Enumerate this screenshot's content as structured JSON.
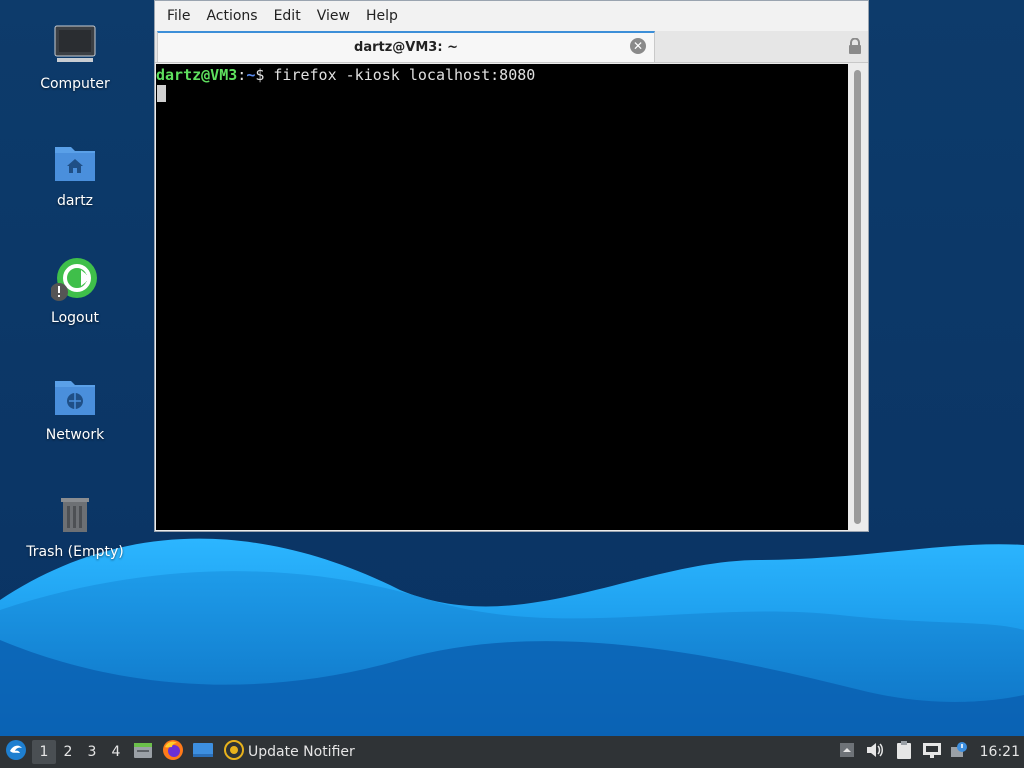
{
  "desktop": {
    "icons": [
      {
        "label": "Computer",
        "icon": "computer-icon"
      },
      {
        "label": "dartz",
        "icon": "home-folder-icon"
      },
      {
        "label": "Logout",
        "icon": "logout-icon"
      },
      {
        "label": "Network",
        "icon": "network-folder-icon"
      },
      {
        "label": "Trash (Empty)",
        "icon": "trash-icon"
      }
    ]
  },
  "terminal": {
    "menu": [
      "File",
      "Actions",
      "Edit",
      "View",
      "Help"
    ],
    "tab_title": "dartz@VM3: ~",
    "prompt_user": "dartz@VM3",
    "prompt_colon": ":",
    "prompt_path": "~",
    "prompt_symbol": "$ ",
    "command": "firefox -kiosk localhost:8080"
  },
  "taskbar": {
    "workspaces": [
      "1",
      "2",
      "3",
      "4"
    ],
    "active_workspace": "1",
    "launchers": [
      "start-menu-icon",
      "file-manager-icon",
      "firefox-icon",
      "show-desktop-icon"
    ],
    "update_notifier": "Update Notifier",
    "clock": "16:21"
  },
  "colors": {
    "desktop_dark": "#0b3a6a",
    "wave_light": "#1fa0f0",
    "prompt_green": "#5ee05e",
    "prompt_blue": "#5b8cf0",
    "taskbar": "#2f3336"
  }
}
